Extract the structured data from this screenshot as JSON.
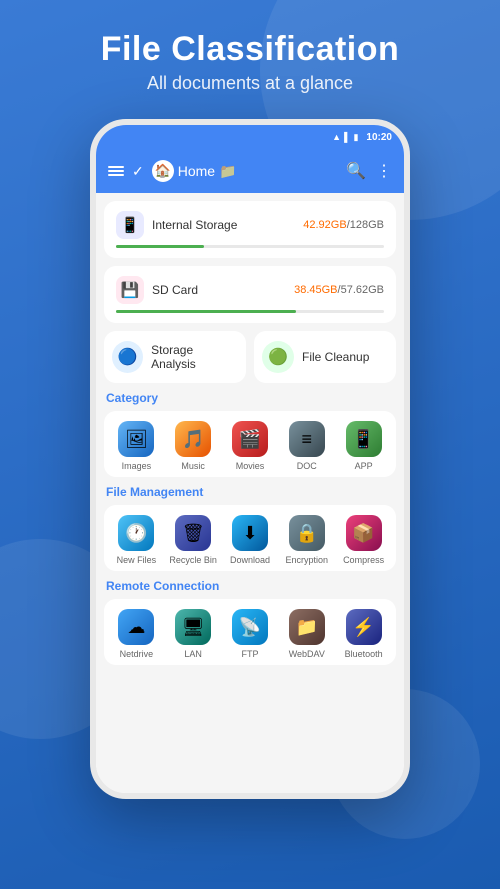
{
  "page": {
    "title": "File Classification",
    "subtitle": "All documents at a glance"
  },
  "statusBar": {
    "time": "10:20",
    "wifi": "wifi",
    "signal": "signal",
    "battery": "battery"
  },
  "appBar": {
    "homeLabel": "Home",
    "searchIcon": "search",
    "moreIcon": "more"
  },
  "storage": {
    "internal": {
      "name": "Internal Storage",
      "usedGB": "42.92GB",
      "totalGB": "128GB",
      "fillPercent": 33
    },
    "sdcard": {
      "name": "SD Card",
      "usedGB": "38.45GB",
      "totalGB": "57.62GB",
      "fillPercent": 67
    }
  },
  "utilities": {
    "storageAnalysis": "Storage Analysis",
    "fileCleanup": "File Cleanup"
  },
  "category": {
    "title": "Category",
    "items": [
      {
        "label": "Images",
        "icon": "🖼"
      },
      {
        "label": "Music",
        "icon": "🎵"
      },
      {
        "label": "Movies",
        "icon": "🎬"
      },
      {
        "label": "DOC",
        "icon": "📄"
      },
      {
        "label": "APP",
        "icon": "📱"
      }
    ]
  },
  "fileManagement": {
    "title": "File Management",
    "items": [
      {
        "label": "New Files",
        "icon": "🕐"
      },
      {
        "label": "Recycle Bin",
        "icon": "🗑"
      },
      {
        "label": "Download",
        "icon": "⬇"
      },
      {
        "label": "Encryption",
        "icon": "🔒"
      },
      {
        "label": "Compress",
        "icon": "📦"
      }
    ]
  },
  "remoteConnection": {
    "title": "Remote Connection",
    "items": [
      {
        "label": "Netdrive",
        "icon": "☁"
      },
      {
        "label": "LAN",
        "icon": "🖥"
      },
      {
        "label": "FTP",
        "icon": "📡"
      },
      {
        "label": "WebDAV",
        "icon": "📁"
      },
      {
        "label": "Bluetooth",
        "icon": "🔵"
      }
    ]
  }
}
